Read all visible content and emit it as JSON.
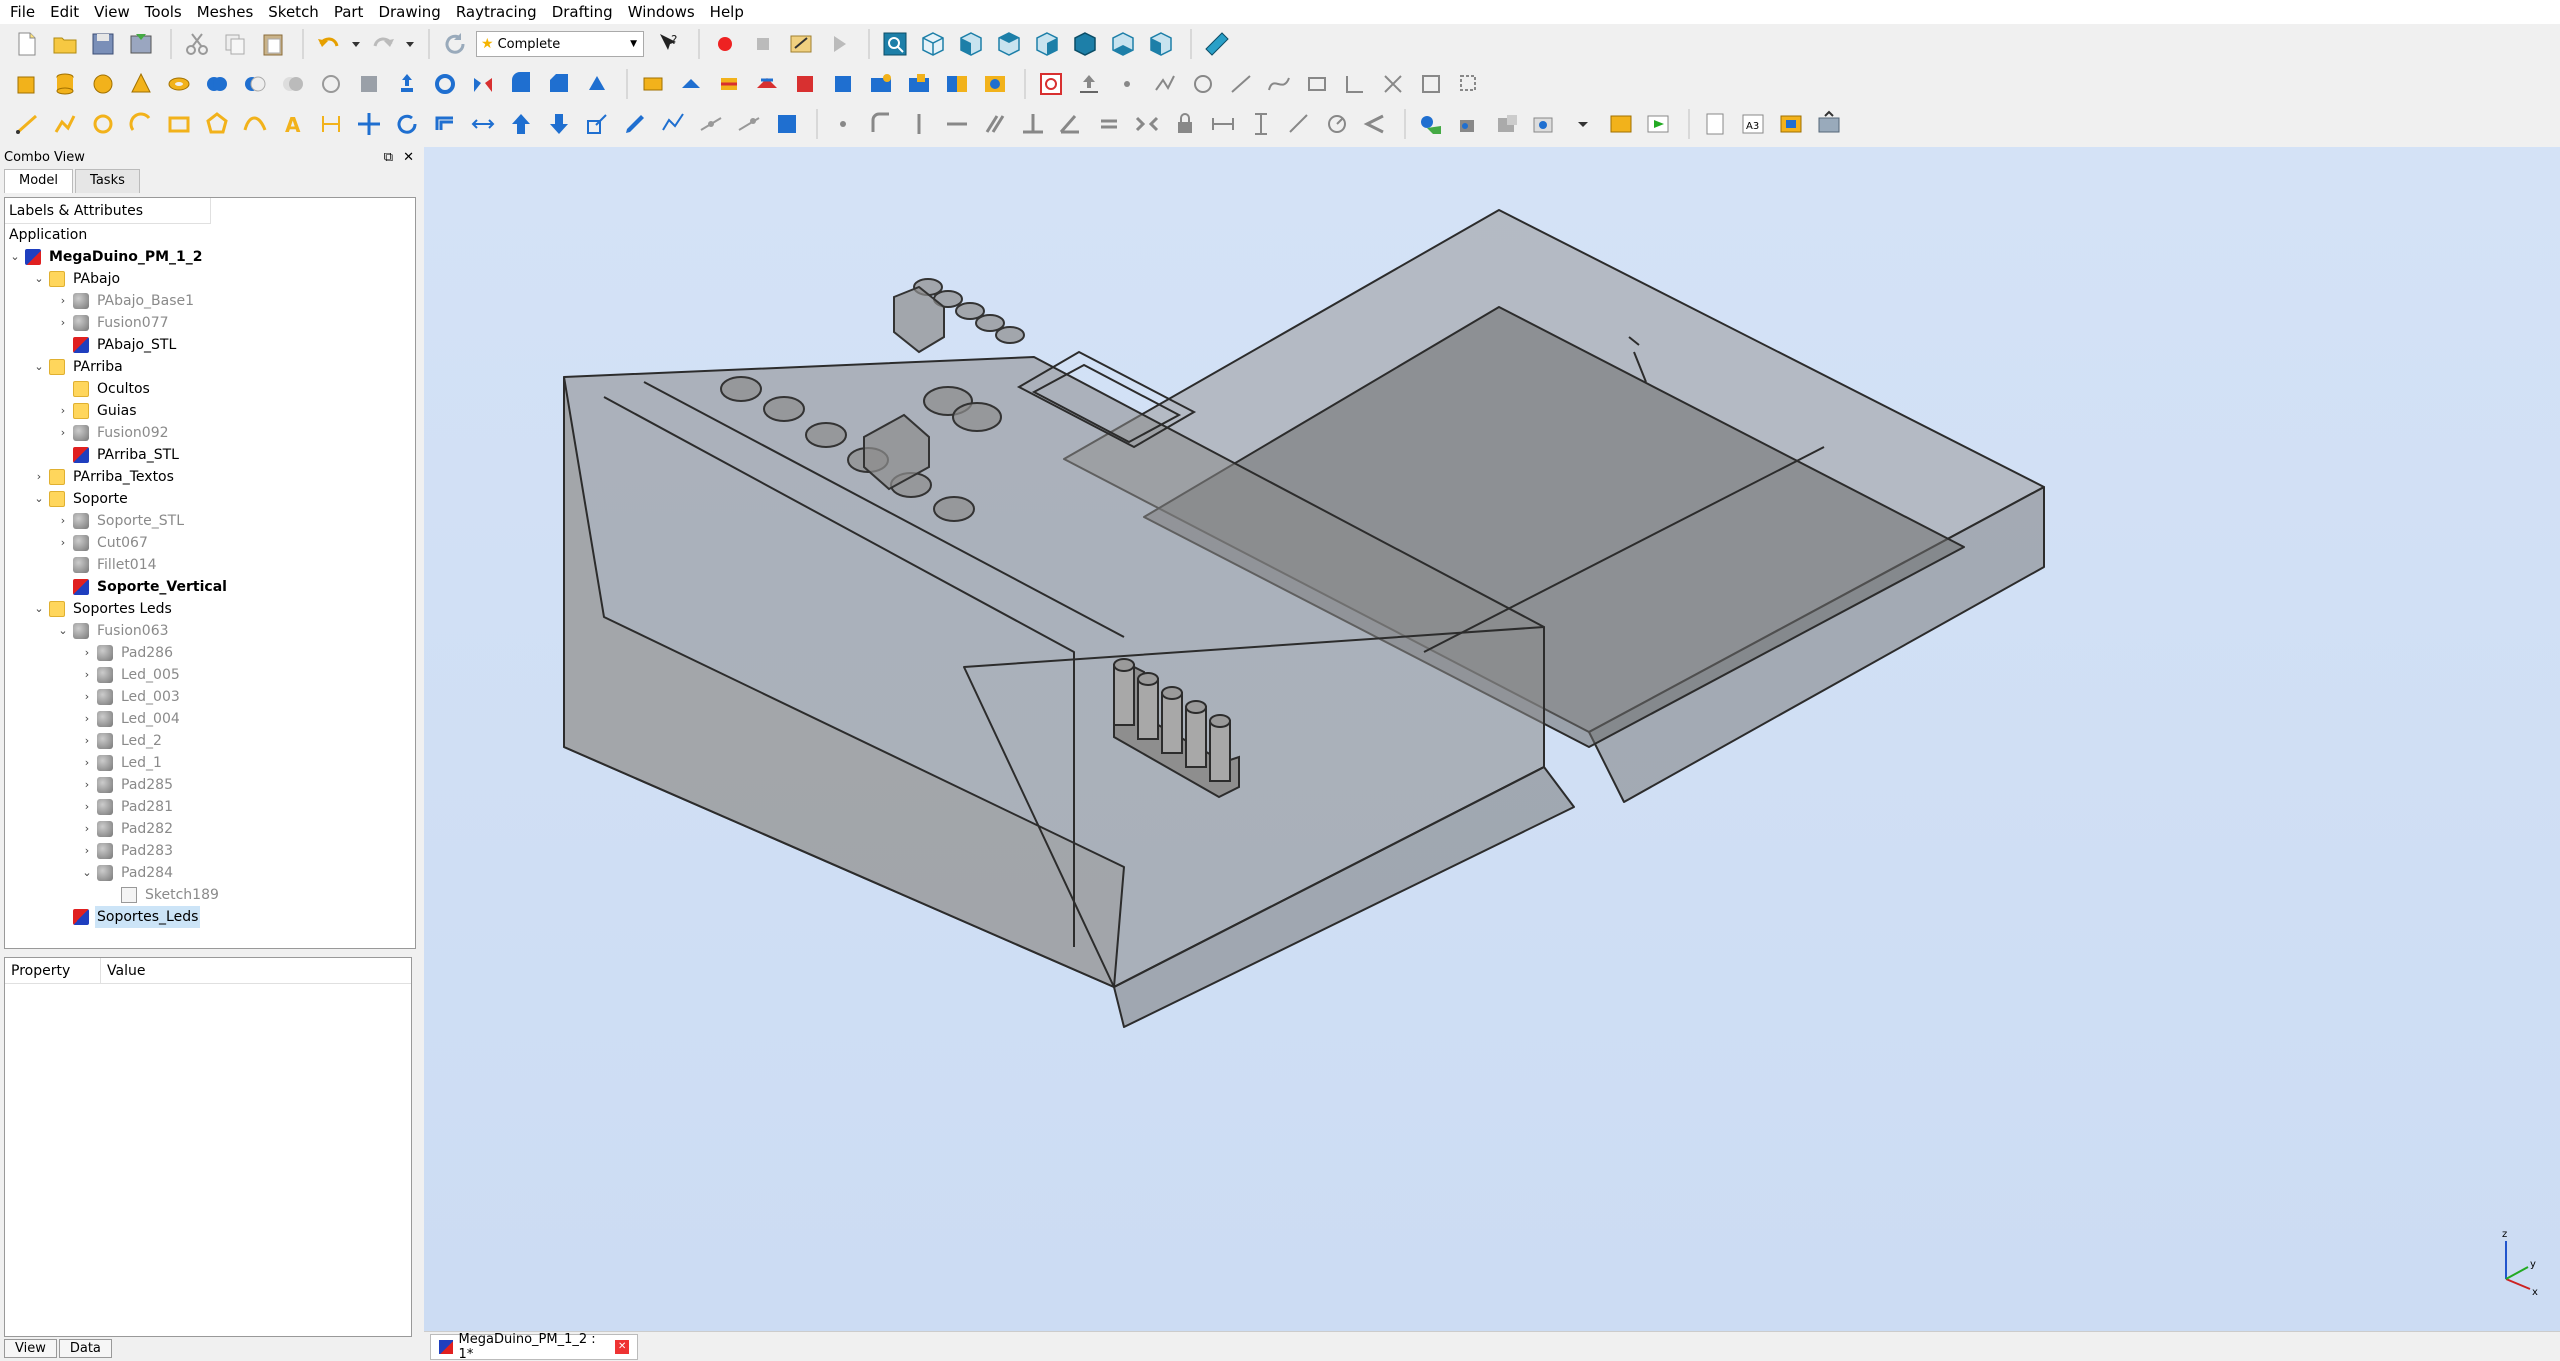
{
  "menubar": [
    "File",
    "Edit",
    "View",
    "Tools",
    "Meshes",
    "Sketch",
    "Part",
    "Drawing",
    "Raytracing",
    "Drafting",
    "Windows",
    "Help"
  ],
  "workbench": {
    "selected": "Complete"
  },
  "combo": {
    "title": "Combo View",
    "tabs": [
      "Model",
      "Tasks"
    ],
    "tree_header": "Labels & Attributes",
    "root_label": "Application"
  },
  "tree": [
    {
      "label": "MegaDuino_PM_1_2",
      "indent": 0,
      "chev": "open",
      "icon": "doc",
      "bold": true
    },
    {
      "label": "PAbajo",
      "indent": 1,
      "chev": "open",
      "icon": "folder"
    },
    {
      "label": "PAbajo_Base1",
      "indent": 2,
      "chev": "closed",
      "icon": "gray",
      "hidden": true
    },
    {
      "label": "Fusion077",
      "indent": 2,
      "chev": "closed",
      "icon": "gray",
      "hidden": true
    },
    {
      "label": "PAbajo_STL",
      "indent": 2,
      "chev": "none",
      "icon": "stl"
    },
    {
      "label": "PArriba",
      "indent": 1,
      "chev": "open",
      "icon": "folder"
    },
    {
      "label": "Ocultos",
      "indent": 2,
      "chev": "none",
      "icon": "folder"
    },
    {
      "label": "Guias",
      "indent": 2,
      "chev": "closed",
      "icon": "folder"
    },
    {
      "label": "Fusion092",
      "indent": 2,
      "chev": "closed",
      "icon": "gray",
      "hidden": true
    },
    {
      "label": "PArriba_STL",
      "indent": 2,
      "chev": "none",
      "icon": "stl"
    },
    {
      "label": "PArriba_Textos",
      "indent": 1,
      "chev": "closed",
      "icon": "folder"
    },
    {
      "label": "Soporte",
      "indent": 1,
      "chev": "open",
      "icon": "folder"
    },
    {
      "label": "Soporte_STL",
      "indent": 2,
      "chev": "closed",
      "icon": "gray",
      "hidden": true
    },
    {
      "label": "Cut067",
      "indent": 2,
      "chev": "closed",
      "icon": "gray",
      "hidden": true
    },
    {
      "label": "Fillet014",
      "indent": 2,
      "chev": "none",
      "icon": "gray",
      "hidden": true
    },
    {
      "label": "Soporte_Vertical",
      "indent": 2,
      "chev": "none",
      "icon": "stl",
      "bold": true
    },
    {
      "label": "Soportes Leds",
      "indent": 1,
      "chev": "open",
      "icon": "folder"
    },
    {
      "label": "Fusion063",
      "indent": 2,
      "chev": "open",
      "icon": "gray",
      "hidden": true
    },
    {
      "label": "Pad286",
      "indent": 3,
      "chev": "closed",
      "icon": "gray",
      "hidden": true
    },
    {
      "label": "Led_005",
      "indent": 3,
      "chev": "closed",
      "icon": "gray",
      "hidden": true
    },
    {
      "label": "Led_003",
      "indent": 3,
      "chev": "closed",
      "icon": "gray",
      "hidden": true
    },
    {
      "label": "Led_004",
      "indent": 3,
      "chev": "closed",
      "icon": "gray",
      "hidden": true
    },
    {
      "label": "Led_2",
      "indent": 3,
      "chev": "closed",
      "icon": "gray",
      "hidden": true
    },
    {
      "label": "Led_1",
      "indent": 3,
      "chev": "closed",
      "icon": "gray",
      "hidden": true
    },
    {
      "label": "Pad285",
      "indent": 3,
      "chev": "closed",
      "icon": "gray",
      "hidden": true
    },
    {
      "label": "Pad281",
      "indent": 3,
      "chev": "closed",
      "icon": "gray",
      "hidden": true
    },
    {
      "label": "Pad282",
      "indent": 3,
      "chev": "closed",
      "icon": "gray",
      "hidden": true
    },
    {
      "label": "Pad283",
      "indent": 3,
      "chev": "closed",
      "icon": "gray",
      "hidden": true
    },
    {
      "label": "Pad284",
      "indent": 3,
      "chev": "open",
      "icon": "gray",
      "hidden": true
    },
    {
      "label": "Sketch189",
      "indent": 4,
      "chev": "none",
      "icon": "sketch",
      "hidden": true
    },
    {
      "label": "Soportes_Leds",
      "indent": 2,
      "chev": "none",
      "icon": "stl",
      "selected": true
    }
  ],
  "property": {
    "col1": "Property",
    "col2": "Value"
  },
  "bottom_tabs": [
    "View",
    "Data"
  ],
  "document_tab": {
    "label": "MegaDuino_PM_1_2 : 1*"
  },
  "colors": {
    "viewport_bg": "#d4e2f6",
    "model_fill": "#8c8c8c",
    "selection": "#cce4f7"
  }
}
